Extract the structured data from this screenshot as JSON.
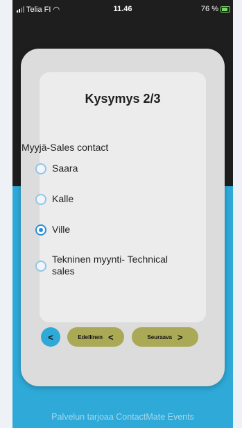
{
  "status": {
    "carrier": "Telia FI",
    "time": "11.46",
    "battery": "76 %"
  },
  "question": {
    "title": "Kysymys 2/3",
    "label": "Myyjä-Sales contact",
    "options": [
      {
        "label": "Saara",
        "selected": false
      },
      {
        "label": "Kalle",
        "selected": false
      },
      {
        "label": "Ville",
        "selected": true
      },
      {
        "label": "Tekninen myynti- Technical sales",
        "selected": false
      }
    ]
  },
  "nav": {
    "back_icon": "<",
    "prev_label": "Edellinen",
    "prev_icon": "<",
    "next_label": "Seuraava",
    "next_icon": ">"
  },
  "footer": {
    "text": "Palvelun tarjoaa ContactMate Events"
  },
  "colors": {
    "accent": "#2ea9d8",
    "button": "#aaa956",
    "radio": "#2b8fd8"
  }
}
